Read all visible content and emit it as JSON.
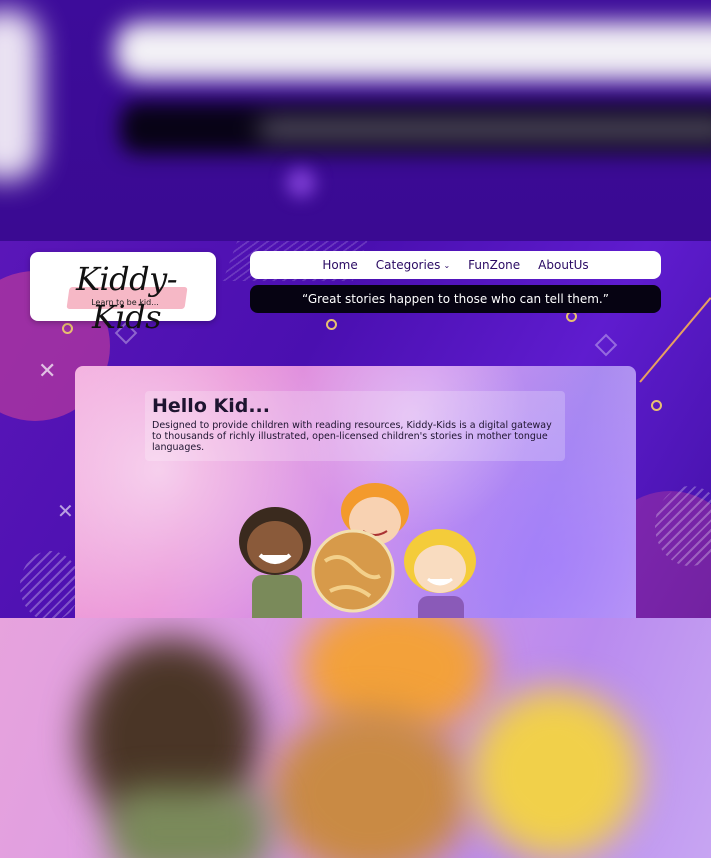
{
  "logo": {
    "title": "Kiddy-Kids",
    "tagline": "Learn to be kid..."
  },
  "nav": {
    "items": [
      {
        "label": "Home"
      },
      {
        "label": "Categories",
        "has_dropdown": true
      },
      {
        "label": "FunZone"
      },
      {
        "label": "AboutUs"
      }
    ]
  },
  "quote": "“Great stories happen to those who can tell them.”",
  "hero": {
    "title": "Hello Kid...",
    "description": "Designed to provide children with reading resources, Kiddy-Kids is a digital gateway to thousands of richly illustrated, open-licensed children's stories in mother tongue languages."
  },
  "colors": {
    "background": "#4a0fb0",
    "nav_bg": "#ffffff",
    "nav_text": "#2a0a63",
    "quote_bg": "#060312",
    "logo_brush": "#f6b8c6"
  },
  "icons": [
    "chevron-down-icon"
  ]
}
